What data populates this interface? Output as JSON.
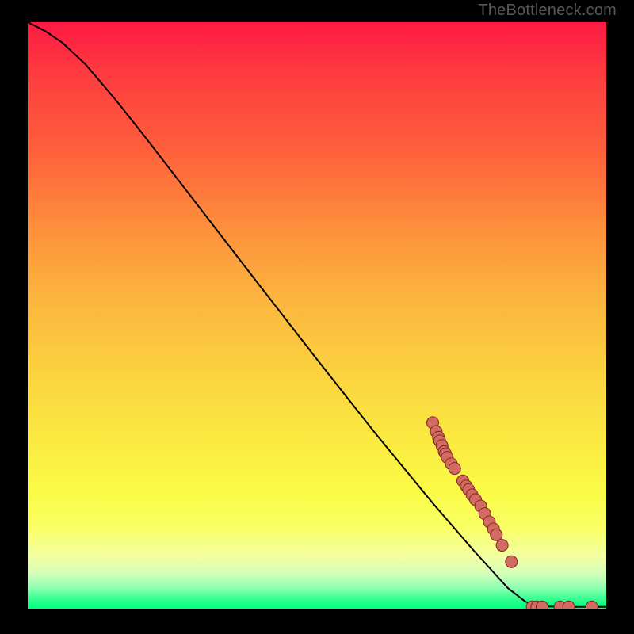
{
  "attribution": "TheBottleneck.com",
  "chart_data": {
    "type": "line",
    "title": "",
    "xlabel": "",
    "ylabel": "",
    "xlim": [
      0,
      1
    ],
    "ylim": [
      0,
      1
    ],
    "curve": [
      {
        "x": 0.0,
        "y": 1.0
      },
      {
        "x": 0.03,
        "y": 0.985
      },
      {
        "x": 0.06,
        "y": 0.965
      },
      {
        "x": 0.1,
        "y": 0.928
      },
      {
        "x": 0.15,
        "y": 0.87
      },
      {
        "x": 0.2,
        "y": 0.808
      },
      {
        "x": 0.3,
        "y": 0.68
      },
      {
        "x": 0.4,
        "y": 0.552
      },
      {
        "x": 0.5,
        "y": 0.425
      },
      {
        "x": 0.6,
        "y": 0.3
      },
      {
        "x": 0.7,
        "y": 0.18
      },
      {
        "x": 0.77,
        "y": 0.1
      },
      {
        "x": 0.83,
        "y": 0.035
      },
      {
        "x": 0.86,
        "y": 0.012
      },
      {
        "x": 0.885,
        "y": 0.004
      },
      {
        "x": 0.92,
        "y": 0.003
      },
      {
        "x": 1.0,
        "y": 0.003
      }
    ],
    "series": [
      {
        "name": "datapoints",
        "color": "#d46b62",
        "points": [
          {
            "x": 0.7,
            "y": 0.317
          },
          {
            "x": 0.706,
            "y": 0.302
          },
          {
            "x": 0.71,
            "y": 0.292
          },
          {
            "x": 0.712,
            "y": 0.286
          },
          {
            "x": 0.716,
            "y": 0.278
          },
          {
            "x": 0.72,
            "y": 0.268
          },
          {
            "x": 0.722,
            "y": 0.264
          },
          {
            "x": 0.725,
            "y": 0.258
          },
          {
            "x": 0.732,
            "y": 0.247
          },
          {
            "x": 0.738,
            "y": 0.239
          },
          {
            "x": 0.752,
            "y": 0.218
          },
          {
            "x": 0.758,
            "y": 0.209
          },
          {
            "x": 0.762,
            "y": 0.203
          },
          {
            "x": 0.768,
            "y": 0.194
          },
          {
            "x": 0.774,
            "y": 0.186
          },
          {
            "x": 0.783,
            "y": 0.175
          },
          {
            "x": 0.79,
            "y": 0.162
          },
          {
            "x": 0.798,
            "y": 0.148
          },
          {
            "x": 0.805,
            "y": 0.136
          },
          {
            "x": 0.81,
            "y": 0.126
          },
          {
            "x": 0.82,
            "y": 0.108
          },
          {
            "x": 0.836,
            "y": 0.08
          },
          {
            "x": 0.872,
            "y": 0.003
          },
          {
            "x": 0.88,
            "y": 0.003
          },
          {
            "x": 0.889,
            "y": 0.003
          },
          {
            "x": 0.92,
            "y": 0.003
          },
          {
            "x": 0.935,
            "y": 0.003
          },
          {
            "x": 0.975,
            "y": 0.003
          }
        ]
      }
    ]
  },
  "colors": {
    "point_fill": "#d46b62",
    "point_stroke": "#7a2822",
    "curve_stroke": "#000000"
  }
}
